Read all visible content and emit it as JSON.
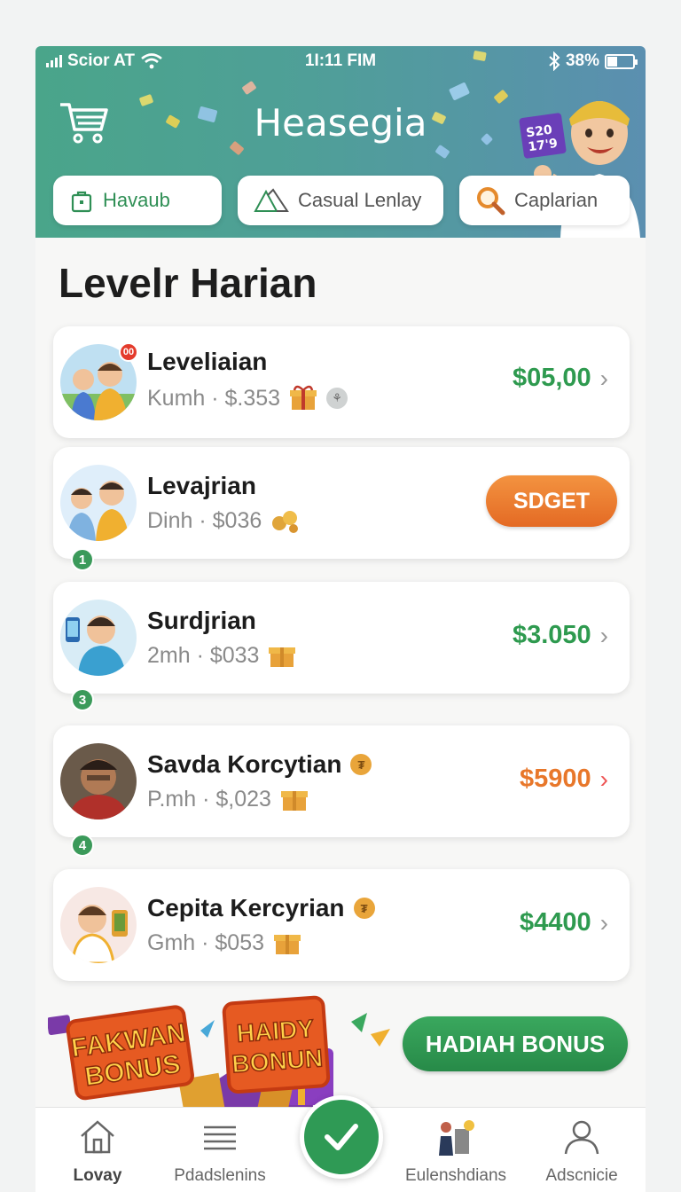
{
  "status_bar": {
    "carrier": "Scior AT",
    "time": "1I:11 FIM",
    "battery": "38%"
  },
  "header": {
    "title": "Heasegia",
    "mascot_sign": [
      "S20",
      "17'9"
    ],
    "tabs": [
      {
        "label": "Havaub",
        "icon": "bag-icon"
      },
      {
        "label": "Casual Lenlay",
        "icon": "tent-icon"
      },
      {
        "label": "Caplarian",
        "icon": "magnifier-icon"
      }
    ]
  },
  "section": {
    "title": "Levelr Harian"
  },
  "leaderboard": [
    {
      "name": "Leveliaian",
      "sub": "Kumh · $.353",
      "amount": "$05,00",
      "rank": "",
      "badge": "",
      "notif": "00"
    },
    {
      "name": "Levajrian",
      "sub": "Dinh · $036",
      "button": "SDGET",
      "rank": "1"
    },
    {
      "name": "Surdjrian",
      "sub": "2mh · $033",
      "amount": "$3.050",
      "rank": "3"
    },
    {
      "name": "Savda Korcytian",
      "sub": "P.mh · $,023",
      "amount": "$5900",
      "rank": "4"
    },
    {
      "name": "Cepita Kercyrian",
      "sub": "Gmh · $053",
      "amount": "$4400",
      "rank": ""
    }
  ],
  "promo": {
    "banner_left": [
      "FAKWAN",
      "BONUS"
    ],
    "banner_right": [
      "HAIDY",
      "BONUN"
    ],
    "button": "HADIAH BONUS"
  },
  "tabbar": [
    {
      "label": "Lovay",
      "icon": "home-icon"
    },
    {
      "label": "Pdadslenins",
      "icon": "list-icon"
    },
    {
      "label": "Eulenshdians",
      "icon": "person-icon"
    },
    {
      "label": "Adscnicie",
      "icon": "profile-icon"
    }
  ],
  "colors": {
    "accent_green": "#2f9a55",
    "accent_orange": "#e8772a",
    "header_teal": "#4aa58a"
  }
}
